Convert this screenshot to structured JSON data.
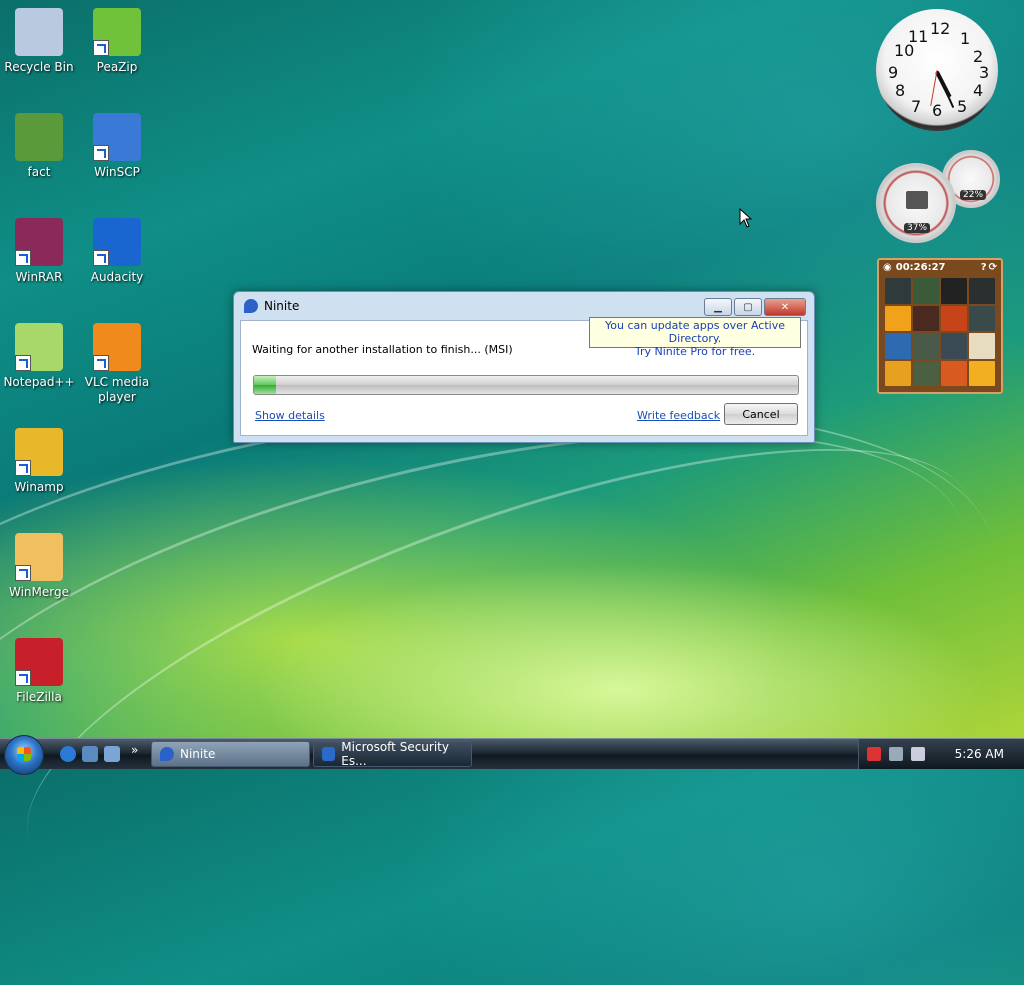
{
  "desktop": {
    "icons": [
      {
        "label": "Recycle Bin",
        "icon": "recycle-bin-icon",
        "color": "#b8c9e0"
      },
      {
        "label": "PeaZip",
        "icon": "peazip-icon",
        "color": "#6fc23a"
      },
      {
        "label": "fact",
        "icon": "fact-icon",
        "color": "#5a9a3a"
      },
      {
        "label": "WinSCP",
        "icon": "winscp-icon",
        "color": "#3a7ad6"
      },
      {
        "label": "WinRAR",
        "icon": "winrar-icon",
        "color": "#8b2a5a"
      },
      {
        "label": "Audacity",
        "icon": "audacity-icon",
        "color": "#1a66d1"
      },
      {
        "label": "Notepad++",
        "icon": "notepad-plus-plus-icon",
        "color": "#a8d86a"
      },
      {
        "label": "VLC media player",
        "icon": "vlc-icon",
        "color": "#f08a1c"
      },
      {
        "label": "Winamp",
        "icon": "winamp-icon",
        "color": "#e8b82a"
      },
      {
        "label": "WinMerge",
        "icon": "winmerge-icon",
        "color": "#f0c060"
      },
      {
        "label": "FileZilla",
        "icon": "filezilla-icon",
        "color": "#c8202a"
      }
    ]
  },
  "gadgets": {
    "clock": {
      "time": "5:26"
    },
    "cpu_meter": {
      "cpu": "37%",
      "memory": "22%"
    },
    "puzzle": {
      "timer": "00:26:27"
    }
  },
  "window": {
    "title": "Ninite",
    "tooltip_line1": "You can update apps over Active Directory.",
    "tooltip_line2": "Try Ninite Pro for free.",
    "status": "Waiting for another installation to finish... (MSI)",
    "progress": 0.04,
    "show_details": "Show details",
    "write_feedback": "Write feedback",
    "cancel": "Cancel"
  },
  "taskbar": {
    "tasks": [
      {
        "label": "Ninite",
        "active": true
      },
      {
        "label": "Microsoft Security Es...",
        "active": false
      }
    ],
    "quicklaunch_more": "»",
    "time": "5:26 AM"
  }
}
